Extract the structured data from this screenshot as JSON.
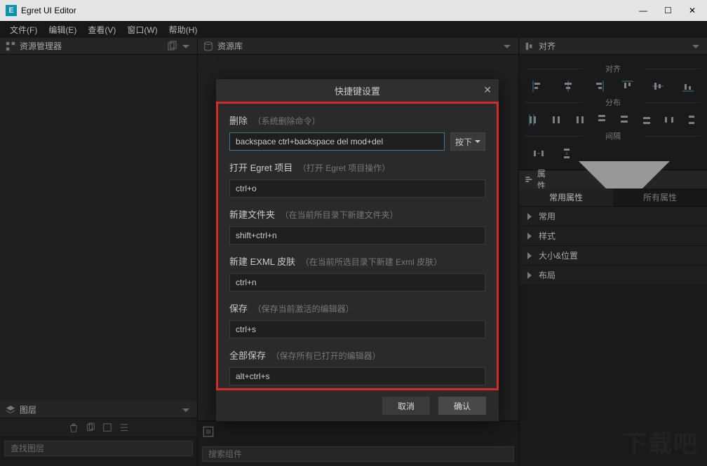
{
  "window": {
    "title": "Egret UI Editor",
    "logo_text": "E"
  },
  "menubar": {
    "file": "文件(F)",
    "edit": "编辑(E)",
    "view": "查看(V)",
    "window": "窗口(W)",
    "help": "帮助(H)"
  },
  "panels": {
    "explorer": "资源管理器",
    "resource_lib": "资源库",
    "align": "对齐",
    "layers": "图层",
    "properties": "属性"
  },
  "search_placeholder_layers": "查找图层",
  "search_placeholder_components": "搜索组件",
  "align_labels": {
    "align": "对齐",
    "distribute": "分布",
    "spacing": "间隔"
  },
  "prop_tabs": {
    "common": "常用属性",
    "all": "所有属性"
  },
  "prop_sections": [
    "常用",
    "样式",
    "大小&位置",
    "布局"
  ],
  "modal": {
    "title": "快捷键设置",
    "cancel": "取消",
    "ok": "确认",
    "trigger_label": "按下",
    "items": [
      {
        "name": "删除",
        "hint": "（系统删除命令）",
        "value": "backspace ctrl+backspace del mod+del",
        "show_trigger": true,
        "highlight": true
      },
      {
        "name": "打开 Egret 项目",
        "hint": "（打开 Egret 项目操作）",
        "value": "ctrl+o"
      },
      {
        "name": "新建文件夹",
        "hint": "（在当前所目录下新建文件夹）",
        "value": "shift+ctrl+n"
      },
      {
        "name": "新建 EXML 皮肤",
        "hint": "（在当前所选目录下新建 Exml 皮肤）",
        "value": "ctrl+n"
      },
      {
        "name": "保存",
        "hint": "（保存当前激活的编辑器）",
        "value": "ctrl+s"
      },
      {
        "name": "全部保存",
        "hint": "（保存所有已打开的编辑器）",
        "value": "alt+ctrl+s"
      }
    ]
  },
  "watermark": "下载吧"
}
